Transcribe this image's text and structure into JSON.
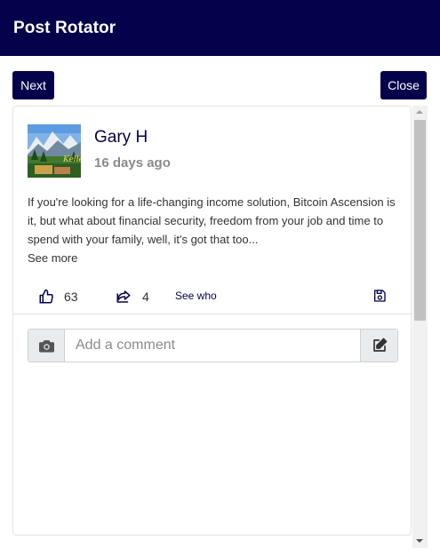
{
  "header": {
    "title": "Post Rotator"
  },
  "toolbar": {
    "next_label": "Next",
    "close_label": "Close"
  },
  "post": {
    "author": "Gary H",
    "time_ago": "16 days ago",
    "body": "If you're looking for a life-changing income solution, Bitcoin Ascension is it, but what about financial security, freedom from your job and time to spend with your family, well, it's got that too...",
    "see_more": "See more",
    "likes": "63",
    "shares": "4",
    "see_who": "See who"
  },
  "comment": {
    "placeholder": "Add a comment"
  },
  "icons": {
    "like": "thumbs-up-icon",
    "share": "share-icon",
    "save": "save-icon",
    "camera": "camera-icon",
    "edit": "edit-icon"
  },
  "colors": {
    "brand": "#04024a",
    "muted": "#8a8a8a",
    "addon_bg": "#e9ecef"
  }
}
